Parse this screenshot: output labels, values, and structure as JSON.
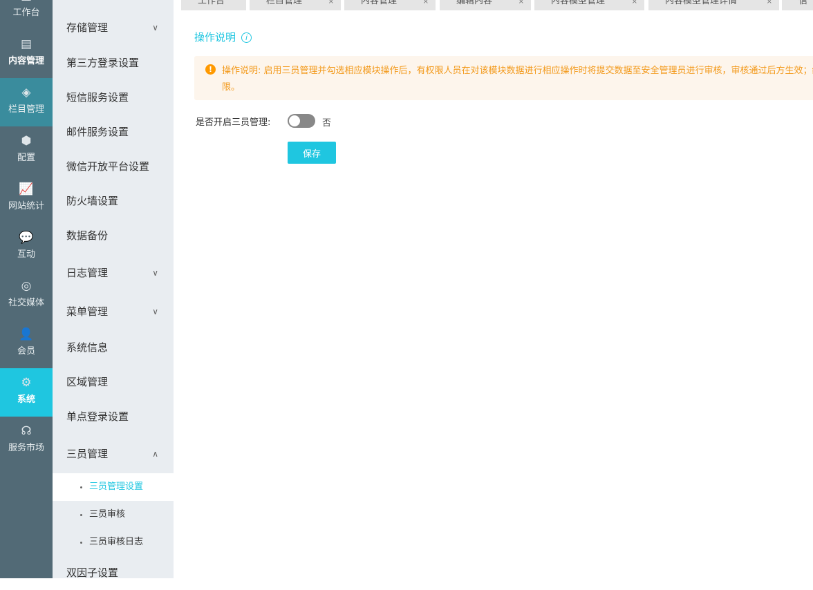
{
  "rail": [
    {
      "label": "工作台",
      "icon": "dashboard-icon"
    },
    {
      "label": "内容管理",
      "icon": "document-icon"
    },
    {
      "label": "栏目管理",
      "icon": "layers-icon"
    },
    {
      "label": "配置",
      "icon": "cube-icon"
    },
    {
      "label": "网站统计",
      "icon": "chart-icon"
    },
    {
      "label": "互动",
      "icon": "chat-icon"
    },
    {
      "label": "社交媒体",
      "icon": "social-icon"
    },
    {
      "label": "会员",
      "icon": "member-icon"
    },
    {
      "label": "系统",
      "icon": "gear-icon"
    },
    {
      "label": "服务市场",
      "icon": "service-icon"
    }
  ],
  "menu": [
    {
      "label": "存储管理",
      "chev": "∨"
    },
    {
      "label": "第三方登录设置"
    },
    {
      "label": "短信服务设置"
    },
    {
      "label": "邮件服务设置"
    },
    {
      "label": "微信开放平台设置"
    },
    {
      "label": "防火墙设置"
    },
    {
      "label": "数据备份"
    },
    {
      "label": "日志管理",
      "chev": "∨"
    },
    {
      "label": "菜单管理",
      "chev": "∨"
    },
    {
      "label": "系统信息"
    },
    {
      "label": "区域管理"
    },
    {
      "label": "单点登录设置"
    },
    {
      "label": "三员管理",
      "chev": "∧"
    }
  ],
  "submenu": [
    "三员管理设置",
    "三员审核",
    "三员审核日志"
  ],
  "menu_last": "双因子设置",
  "tabs": [
    "工作台",
    "栏目管理",
    "内容管理",
    "编辑内容",
    "内容模型管理",
    "内容模型管理详情",
    "信"
  ],
  "main": {
    "title": "操作说明",
    "notice": "操作说明: 启用三员管理并勾选相应模块操作后，有权限人员在对该模块数据进行相应操作时将提交数据至安全管理员进行审核，审核通过后方生效；终限。",
    "toggle_label": "是否开启三员管理:",
    "toggle_state": "否",
    "save": "保存"
  }
}
